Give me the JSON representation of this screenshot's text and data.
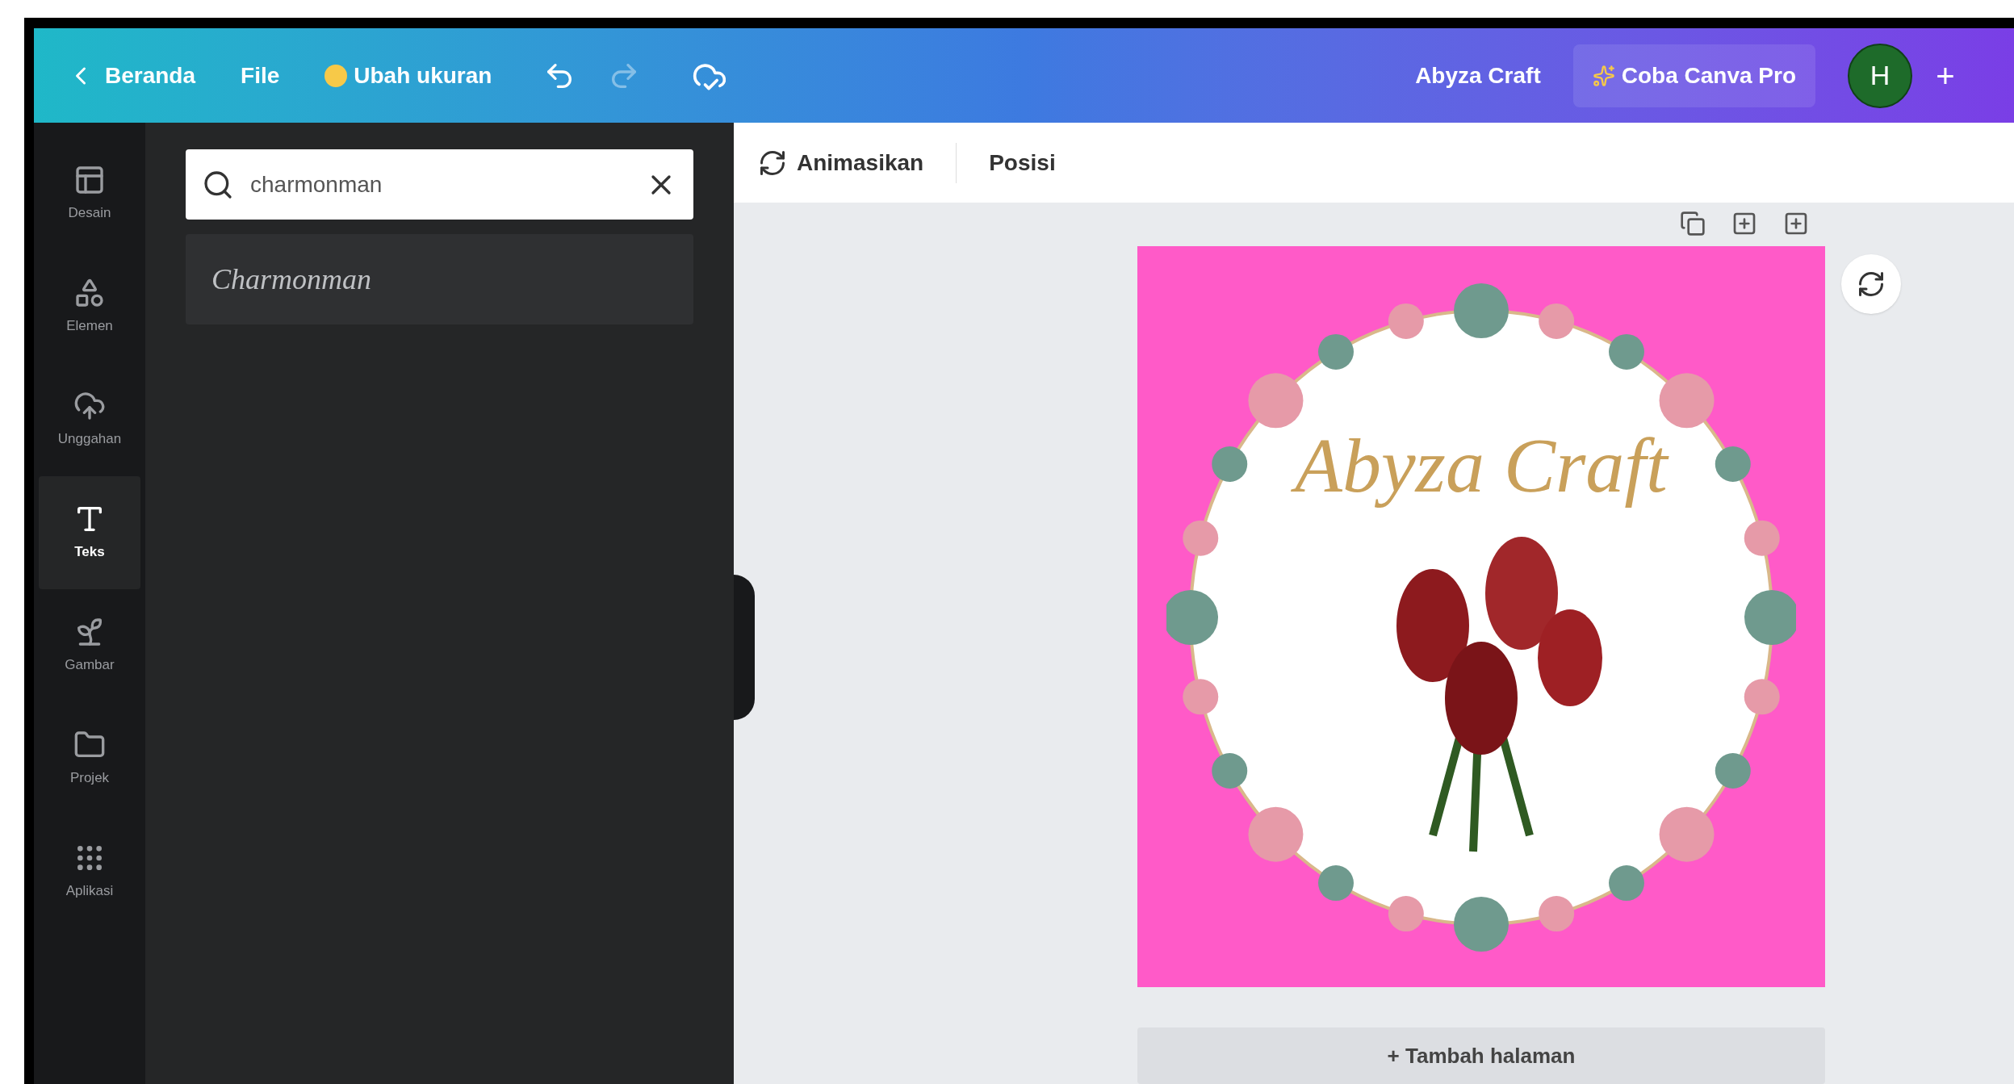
{
  "top_bar": {
    "back": "Beranda",
    "file": "File",
    "resize": "Ubah ukuran",
    "redo": {
      "disabled": true
    },
    "project_name": "Abyza Craft",
    "pro_button": "Coba Canva Pro",
    "avatar": "H",
    "add": "+"
  },
  "sidebar": {
    "items": [
      {
        "label": "Desain",
        "selected": false
      },
      {
        "label": "Elemen",
        "selected": false
      },
      {
        "label": "Unggahan",
        "selected": false
      },
      {
        "label": "Teks",
        "selected": true
      },
      {
        "label": "Gambar",
        "selected": false
      },
      {
        "label": "Projek",
        "selected": false
      },
      {
        "label": "Aplikasi",
        "selected": false
      }
    ]
  },
  "panel": {
    "search": {
      "value": "charmonman"
    },
    "results": [
      "Charmonman"
    ]
  },
  "toolbar": {
    "items": [
      "Animasikan",
      "Posisi"
    ]
  },
  "canvas": {
    "design_text": "Abyza Craft",
    "add_page": "+ Tambah halaman"
  }
}
